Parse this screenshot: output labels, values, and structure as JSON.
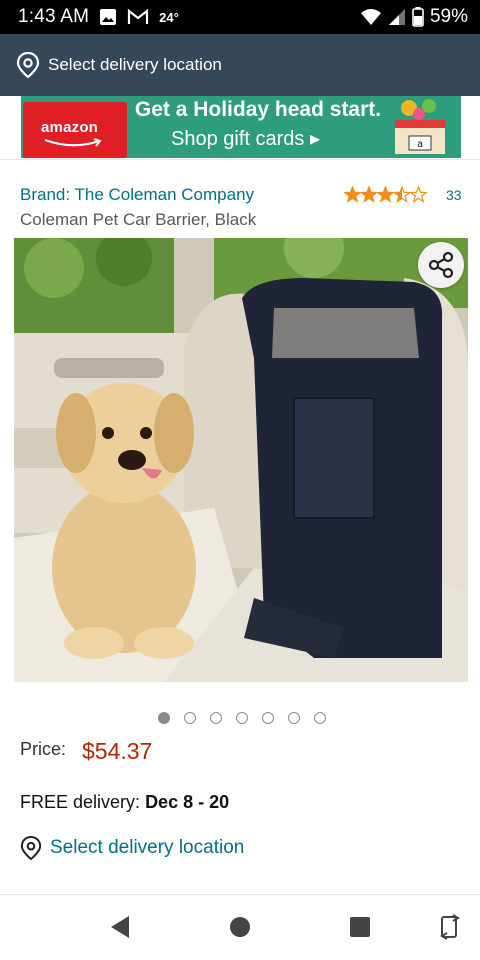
{
  "status_bar": {
    "time": "1:43 AM",
    "weather": "24°",
    "battery": "59%"
  },
  "header": {
    "delivery_text": "Select delivery location"
  },
  "banner": {
    "card_logo": "amazon",
    "title": "Get a Holiday head start.",
    "subtitle": "Shop gift cards ▸"
  },
  "product": {
    "brand": "Brand: The Coleman Company",
    "title": "Coleman Pet Car Barrier, Black",
    "rating": 3.5,
    "rating_count": "33",
    "image_count": 7,
    "active_image": 0
  },
  "pricing": {
    "label": "Price:",
    "value": "$54.37"
  },
  "delivery": {
    "prefix": "FREE delivery:",
    "dates": "Dec 8 - 20",
    "location_link": "Select delivery location"
  },
  "colors": {
    "header_bg": "#37475a",
    "link": "#007185",
    "price": "#b12704",
    "star": "#f08c1a"
  }
}
